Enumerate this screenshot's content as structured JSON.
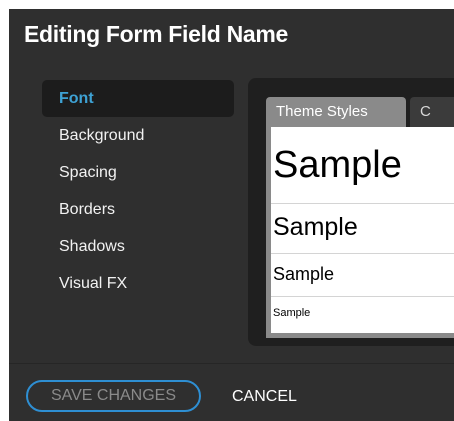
{
  "dialog": {
    "title": "Editing Form Field Name"
  },
  "sidebar": {
    "items": [
      {
        "label": "Font",
        "active": true
      },
      {
        "label": "Background",
        "active": false
      },
      {
        "label": "Spacing",
        "active": false
      },
      {
        "label": "Borders",
        "active": false
      },
      {
        "label": "Shadows",
        "active": false
      },
      {
        "label": "Visual FX",
        "active": false
      }
    ]
  },
  "tabs": {
    "active_label": "Theme Styles",
    "second_label": "C"
  },
  "preview": {
    "samples": [
      "Sample",
      "Sample",
      "Sample",
      "Sample"
    ]
  },
  "footer": {
    "save_label": "SAVE CHANGES",
    "cancel_label": "CANCEL"
  },
  "colors": {
    "dialog_background": "#2f2f2f",
    "panel_background": "#1f1f1f",
    "active_item_text": "#3ea2d4",
    "focus_ring": "#2e8fd3",
    "disabled_text": "#8a8a8a"
  }
}
